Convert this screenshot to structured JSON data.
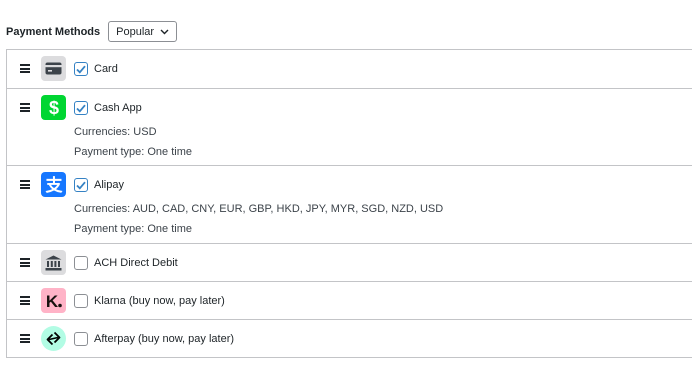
{
  "header": {
    "title": "Payment Methods",
    "sort_value": "Popular"
  },
  "methods": [
    {
      "name": "Card",
      "checked": true,
      "icon": "credit-card-icon",
      "logo_bg": "#dcdcde"
    },
    {
      "name": "Cash App",
      "checked": true,
      "icon": "cash-app-logo",
      "logo_bg": "#00d632",
      "currencies": "Currencies: USD",
      "payment_type": "Payment type: One time"
    },
    {
      "name": "Alipay",
      "checked": true,
      "icon": "alipay-logo",
      "logo_bg": "#1677ff",
      "currencies": "Currencies: AUD, CAD, CNY, EUR, GBP, HKD, JPY, MYR, SGD, NZD, USD",
      "payment_type": "Payment type: One time"
    },
    {
      "name": "ACH Direct Debit",
      "checked": false,
      "icon": "bank-icon",
      "logo_bg": "#dcdcde"
    },
    {
      "name": "Klarna (buy now, pay later)",
      "checked": false,
      "icon": "klarna-logo",
      "logo_bg": "#ffb3c7"
    },
    {
      "name": "Afterpay (buy now, pay later)",
      "checked": false,
      "icon": "afterpay-logo",
      "logo_bg": "#b2fce4"
    }
  ],
  "colors": {
    "accent": "#3582c4",
    "border": "#c3c4c7",
    "text": "#1d2327"
  }
}
